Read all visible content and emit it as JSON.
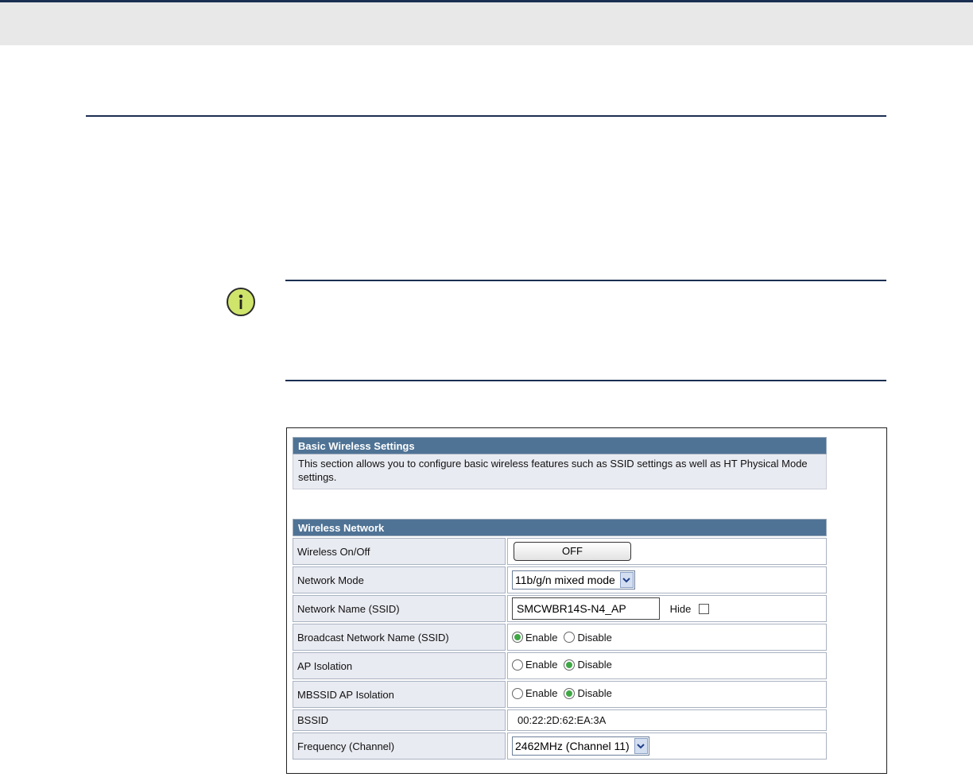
{
  "basic_section": {
    "title": "Basic Wireless Settings",
    "description": "This section allows you to configure basic wireless features such as SSID settings as well as HT Physical Mode settings."
  },
  "network_section": {
    "title": "Wireless Network",
    "wireless_onoff": {
      "label": "Wireless On/Off",
      "button": "OFF"
    },
    "network_mode": {
      "label": "Network Mode",
      "value": "11b/g/n mixed mode"
    },
    "ssid": {
      "label": "Network Name (SSID)",
      "value": "SMCWBR14S-N4_AP",
      "hide_label": "Hide",
      "hide_checked": false
    },
    "broadcast": {
      "label": "Broadcast Network Name (SSID)",
      "enable_label": "Enable",
      "disable_label": "Disable",
      "selected": "Enable"
    },
    "ap_isolation": {
      "label": "AP Isolation",
      "enable_label": "Enable",
      "disable_label": "Disable",
      "selected": "Disable"
    },
    "mbssid_isolation": {
      "label": "MBSSID AP Isolation",
      "enable_label": "Enable",
      "disable_label": "Disable",
      "selected": "Disable"
    },
    "bssid": {
      "label": "BSSID",
      "value": "00:22:2D:62:EA:3A"
    },
    "frequency": {
      "label": "Frequency (Channel)",
      "value": "2462MHz (Channel 11)"
    }
  },
  "colors": {
    "header_bg": "#4f7395",
    "label_bg": "#e9ebf2",
    "rule": "#1b2f52",
    "note_icon": "#cfe46b",
    "radio_on": "#3fa845"
  },
  "icons": {
    "note": "info-icon",
    "dropdown": "chevron-down-icon"
  }
}
